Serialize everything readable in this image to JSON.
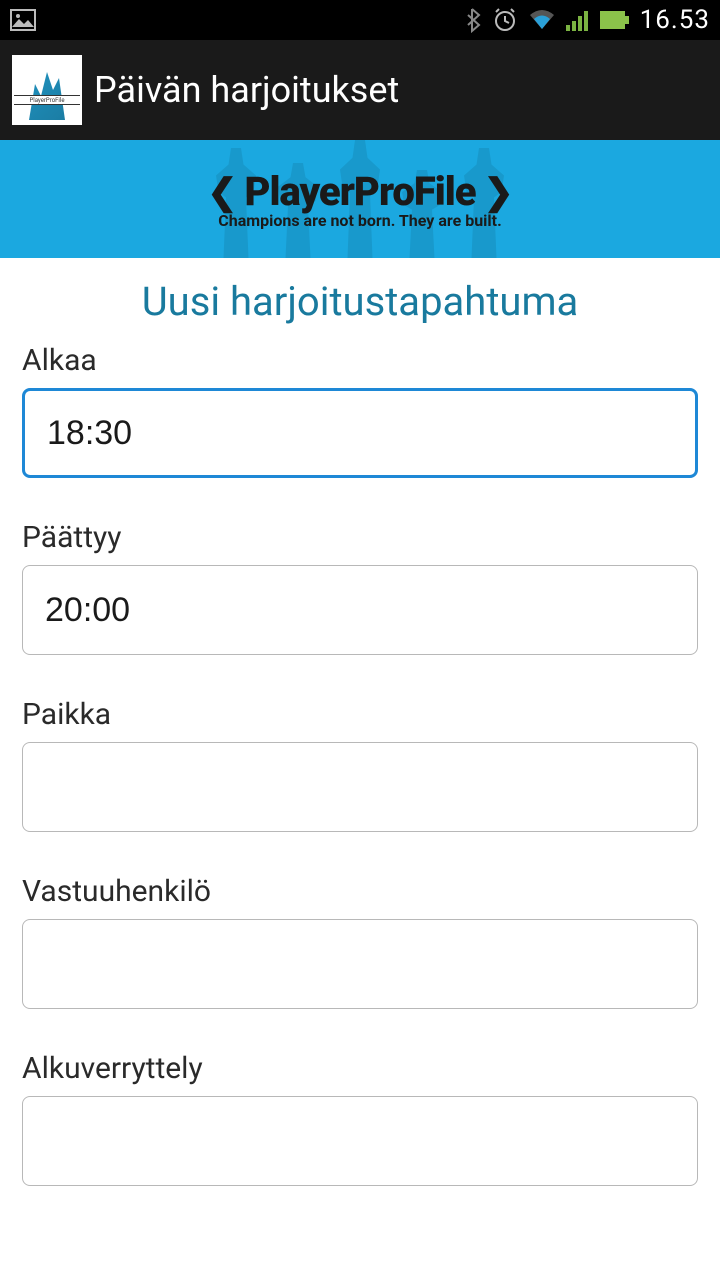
{
  "status": {
    "time": "16.53"
  },
  "appbar": {
    "title": "Päivän harjoitukset"
  },
  "banner": {
    "name": "PlayerProFile",
    "tagline": "Champions are not born. They are built."
  },
  "form": {
    "title": "Uusi harjoitustapahtuma",
    "fields": {
      "alkaa": {
        "label": "Alkaa",
        "value": "18:30"
      },
      "paattyy": {
        "label": "Päättyy",
        "value": "20:00"
      },
      "paikka": {
        "label": "Paikka",
        "value": ""
      },
      "vastuu": {
        "label": "Vastuuhenkilö",
        "value": ""
      },
      "alkuverryttely": {
        "label": "Alkuverryttely",
        "value": ""
      }
    }
  }
}
